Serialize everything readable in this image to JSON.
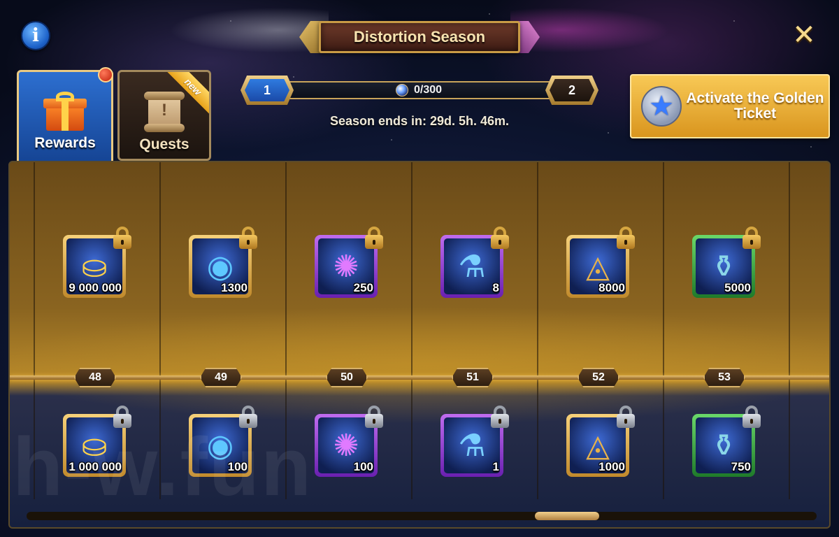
{
  "header": {
    "title": "Distortion Season",
    "info_icon": "info-icon",
    "close_icon": "close-icon"
  },
  "tabs": [
    {
      "label": "Rewards",
      "icon": "gift-icon",
      "active": true,
      "has_notification": true
    },
    {
      "label": "Quests",
      "icon": "scroll-icon",
      "active": false,
      "ribbon": "new"
    }
  ],
  "progress": {
    "current_level": "1",
    "next_level": "2",
    "value_text": "0/300",
    "fraction": 0,
    "season_ends": "Season ends in: 29d. 5h. 46m."
  },
  "golden_ticket": {
    "label": "Activate the Golden Ticket",
    "icon": "star-emblem-icon"
  },
  "levels": [
    {
      "level": "48",
      "top": {
        "qty": "9 000 000",
        "icon": "gold-coin-icon",
        "frame": "gold"
      },
      "bottom": {
        "qty": "1 000 000",
        "icon": "gold-coin-icon",
        "frame": "gold"
      }
    },
    {
      "level": "49",
      "top": {
        "qty": "1300",
        "icon": "eye-orb-icon",
        "frame": "gold"
      },
      "bottom": {
        "qty": "100",
        "icon": "eye-orb-icon",
        "frame": "gold"
      }
    },
    {
      "level": "50",
      "top": {
        "qty": "250",
        "icon": "swirl-cube-icon",
        "frame": "purple"
      },
      "bottom": {
        "qty": "100",
        "icon": "swirl-cube-icon",
        "frame": "purple"
      }
    },
    {
      "level": "51",
      "top": {
        "qty": "8",
        "icon": "potion-flask-icon",
        "frame": "purple"
      },
      "bottom": {
        "qty": "1",
        "icon": "potion-flask-icon",
        "frame": "purple"
      }
    },
    {
      "level": "52",
      "top": {
        "qty": "8000",
        "icon": "triangle-rune-icon",
        "frame": "gold"
      },
      "bottom": {
        "qty": "1000",
        "icon": "triangle-rune-icon",
        "frame": "gold"
      }
    },
    {
      "level": "53",
      "top": {
        "qty": "5000",
        "icon": "elixir-bottle-icon",
        "frame": "green"
      },
      "bottom": {
        "qty": "750",
        "icon": "elixir-bottle-icon",
        "frame": "green"
      }
    }
  ],
  "locks": {
    "top": "gold-lock-icon",
    "bottom": "silver-lock-icon"
  },
  "scroll": {
    "position_fraction": 0.7
  },
  "watermark": "h-w.fun"
}
